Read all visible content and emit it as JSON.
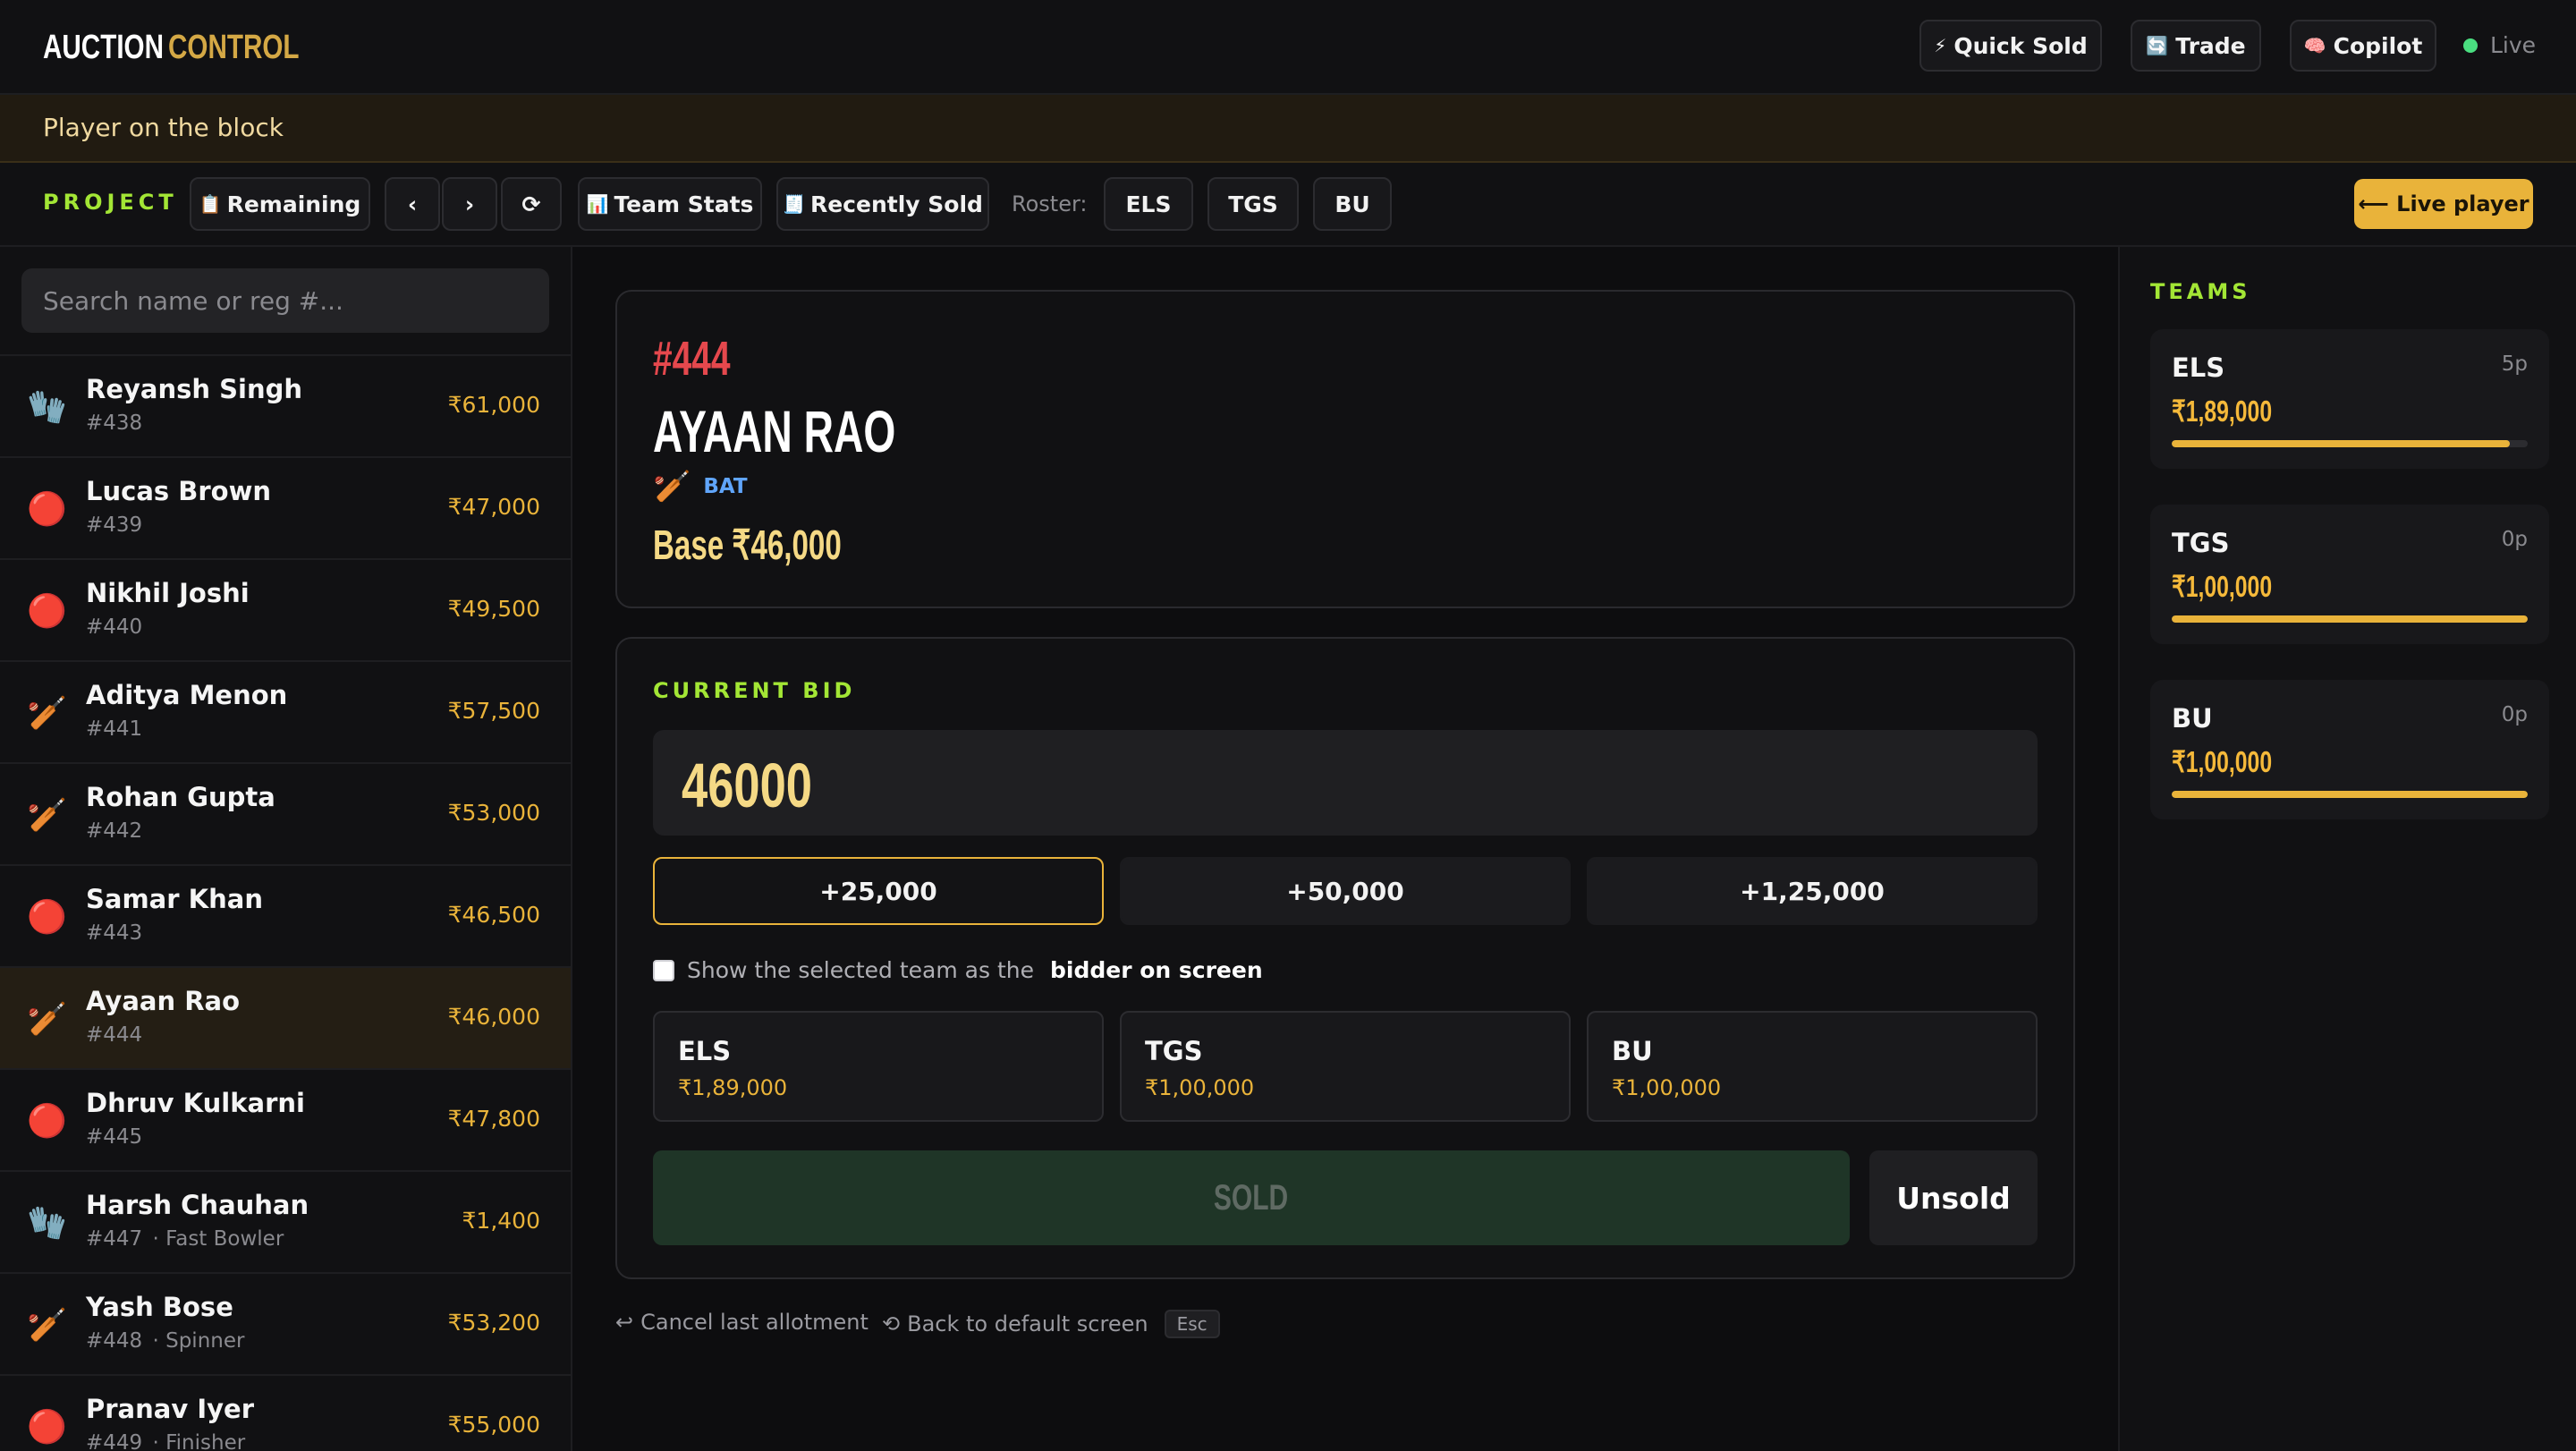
{
  "header": {
    "logo_part1": "AUCTION",
    "logo_part2": "CONTROL",
    "quick_sold": "Quick Sold",
    "quick_sold_icon": "⚡",
    "trade": "Trade",
    "trade_icon": "🔄",
    "copilot": "Copilot",
    "copilot_icon": "🧠",
    "status": "Live",
    "status_color": "#4ade80"
  },
  "banner": {
    "text": "Player on the block"
  },
  "toolbar": {
    "project_label": "PROJECT",
    "remaining": "Remaining",
    "remaining_icon": "📋",
    "prev": "‹",
    "next": "›",
    "refresh": "⟳",
    "team_stats": "Team Stats",
    "team_stats_icon": "📊",
    "recently_sold": "Recently Sold",
    "recently_sold_icon": "🧾",
    "roster_label": "Roster:",
    "roster": [
      "ELS",
      "TGS",
      "BU"
    ],
    "live_player": "⟵ Live player"
  },
  "sidebar": {
    "search_placeholder": "Search name or reg #...",
    "players": [
      {
        "icon": "🧤",
        "name": "Reyansh Singh",
        "reg": "#438",
        "role": "",
        "price": "₹61,000"
      },
      {
        "icon": "🔴",
        "name": "Lucas Brown",
        "reg": "#439",
        "role": "",
        "price": "₹47,000"
      },
      {
        "icon": "🔴",
        "name": "Nikhil Joshi",
        "reg": "#440",
        "role": "",
        "price": "₹49,500"
      },
      {
        "icon": "🏏",
        "name": "Aditya Menon",
        "reg": "#441",
        "role": "",
        "price": "₹57,500"
      },
      {
        "icon": "🏏",
        "name": "Rohan Gupta",
        "reg": "#442",
        "role": "",
        "price": "₹53,000"
      },
      {
        "icon": "🔴",
        "name": "Samar Khan",
        "reg": "#443",
        "role": "",
        "price": "₹46,500"
      },
      {
        "icon": "🏏",
        "name": "Ayaan Rao",
        "reg": "#444",
        "role": "",
        "price": "₹46,000",
        "active": true
      },
      {
        "icon": "🔴",
        "name": "Dhruv Kulkarni",
        "reg": "#445",
        "role": "",
        "price": "₹47,800"
      },
      {
        "icon": "🧤",
        "name": "Harsh Chauhan",
        "reg": "#447",
        "role": " · Fast Bowler",
        "price": "₹1,400"
      },
      {
        "icon": "🏏",
        "name": "Yash Bose",
        "reg": "#448",
        "role": " · Spinner",
        "price": "₹53,200"
      },
      {
        "icon": "🔴",
        "name": "Pranav Iyer",
        "reg": "#449",
        "role": " · Finisher",
        "price": "₹55,000"
      }
    ]
  },
  "player": {
    "lot": "#444",
    "name": "AYAAN RAO",
    "role_icon": "🏏",
    "role": "BAT",
    "base": "Base ₹46,000"
  },
  "bid": {
    "label": "CURRENT BID",
    "value": "46000",
    "increments": [
      "+25,000",
      "+50,000",
      "+1,25,000"
    ],
    "selected_increment": 0,
    "checkbox_text": "Show the selected team as the",
    "checkbox_bold": "bidder on screen",
    "checkbox_checked": false,
    "teams": [
      {
        "name": "ELS",
        "purse": "₹1,89,000"
      },
      {
        "name": "TGS",
        "purse": "₹1,00,000"
      },
      {
        "name": "BU",
        "purse": "₹1,00,000"
      }
    ],
    "sold": "SOLD",
    "unsold": "Unsold"
  },
  "footer": {
    "cancel": "Cancel last allotment",
    "cancel_icon": "↩",
    "back": "Back to default screen",
    "back_icon": "⟲",
    "esc": "Esc"
  },
  "teams_panel": {
    "label": "TEAMS",
    "teams": [
      {
        "name": "ELS",
        "count": "5p",
        "purse": "₹1,89,000",
        "fill": 0.95
      },
      {
        "name": "TGS",
        "count": "0p",
        "purse": "₹1,00,000",
        "fill": 1.0
      },
      {
        "name": "BU",
        "count": "0p",
        "purse": "₹1,00,000",
        "fill": 1.0
      }
    ]
  },
  "colors": {
    "accent": "#e9b33a",
    "lime": "#a3e635",
    "lot": "#e5484d",
    "role": "#60a5fa"
  }
}
